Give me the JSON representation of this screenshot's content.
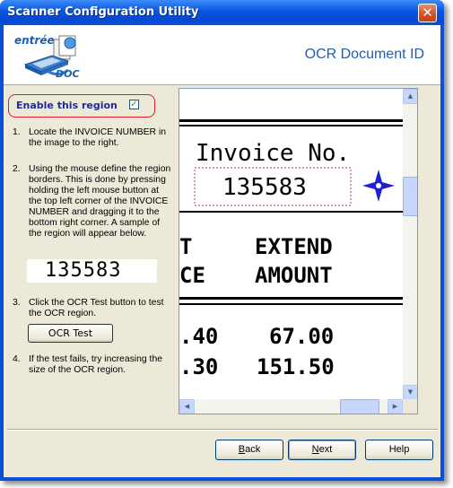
{
  "window": {
    "title": "Scanner Configuration Utility",
    "close_label": "✕"
  },
  "header": {
    "logo_text_top": "entrée",
    "logo_text_bottom": "DOC",
    "title": "OCR Document ID"
  },
  "region": {
    "enable_label": "Enable this region",
    "enabled": true,
    "check_mark": "✓"
  },
  "steps": [
    {
      "num": "1.",
      "text": "Locate the INVOICE NUMBER in the image to the right."
    },
    {
      "num": "2.",
      "text": "Using the mouse define the region borders. This is done by pressing holding the left mouse button at the top left corner of the INVOICE NUMBER and dragging it to the bottom right corner. A sample of the region will appear below."
    },
    {
      "num": "3.",
      "text": "Click the OCR Test button to test the OCR region."
    },
    {
      "num": "4.",
      "text": "If the test fails, try increasing the size of the OCR region."
    }
  ],
  "sample_value": "135583",
  "ocr_test_label": "OCR Test",
  "document": {
    "heading": "Invoice No.",
    "invoice_number": "135583",
    "col1_line1": "T",
    "col1_line2": "CE",
    "col2_line1": "EXTEND",
    "col2_line2": "AMOUNT",
    "row1_left": ".40",
    "row1_right": "67.00",
    "row2_left": ".30",
    "row2_right": "151.50"
  },
  "scrollbar": {
    "up_arrow": "▲",
    "down_arrow": "▼",
    "left_arrow": "◀",
    "right_arrow": "▶",
    "vertical_position": 0.3,
    "horizontal_position": 0.95
  },
  "buttons": {
    "back": "Back",
    "back_accel": "B",
    "next": "Next",
    "next_accel": "N",
    "help": "Help"
  },
  "colors": {
    "title_bar": "#0a55e0",
    "header_text": "#1c5fb0",
    "highlight_border": "#e02020",
    "selection_border": "#c03060"
  }
}
